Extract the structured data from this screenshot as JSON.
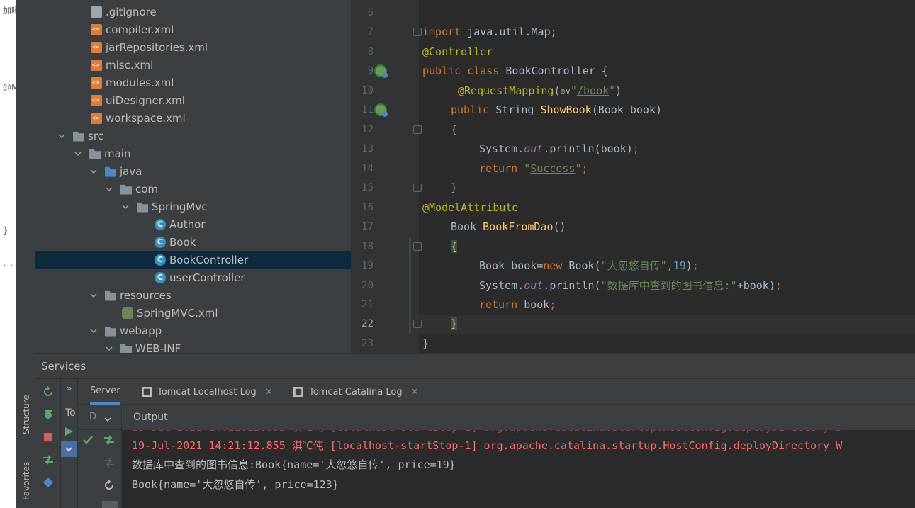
{
  "left_strip": {
    "text1": "加吗",
    "text2": "@M",
    "text3": "}",
    "text4": "` `"
  },
  "tool_stripe": {
    "structure": "Structure",
    "favorites": "Favorites"
  },
  "project_tree": {
    "items": [
      {
        "label": ".gitignore",
        "icon": "git-file-icon"
      },
      {
        "label": "compiler.xml",
        "icon": "xml-file-icon"
      },
      {
        "label": "jarRepositories.xml",
        "icon": "xml-file-icon"
      },
      {
        "label": "misc.xml",
        "icon": "xml-file-icon"
      },
      {
        "label": "modules.xml",
        "icon": "xml-file-icon"
      },
      {
        "label": "uiDesigner.xml",
        "icon": "xml-file-icon"
      },
      {
        "label": "workspace.xml",
        "icon": "xml-file-icon"
      },
      {
        "label": "src",
        "icon": "folder-icon"
      },
      {
        "label": "main",
        "icon": "folder-icon"
      },
      {
        "label": "java",
        "icon": "source-folder-icon"
      },
      {
        "label": "com",
        "icon": "package-icon"
      },
      {
        "label": "SpringMvc",
        "icon": "package-icon"
      },
      {
        "label": "Author",
        "icon": "class-icon"
      },
      {
        "label": "Book",
        "icon": "class-icon"
      },
      {
        "label": "BookController",
        "icon": "class-icon"
      },
      {
        "label": "userController",
        "icon": "class-icon"
      },
      {
        "label": "resources",
        "icon": "resources-folder-icon"
      },
      {
        "label": "SpringMVC.xml",
        "icon": "spring-xml-icon"
      },
      {
        "label": "webapp",
        "icon": "web-folder-icon"
      },
      {
        "label": "WEB-INF",
        "icon": "folder-icon"
      }
    ]
  },
  "editor": {
    "line_numbers": [
      "6",
      "7",
      "8",
      "9",
      "10",
      "11",
      "12",
      "13",
      "14",
      "15",
      "16",
      "17",
      "18",
      "19",
      "20",
      "21",
      "22",
      "23"
    ],
    "lines": {
      "l7_kw": "import",
      "l7_rest": " java.util.Map;",
      "l8_ann": "@Controller",
      "l9_kw": "public class",
      "l9_rest": " BookController {",
      "l10_ann": "@RequestMapping",
      "l10_open": "(",
      "l10_globe": "⊕∨",
      "l10_q1": "\"",
      "l10_path": "/book",
      "l10_q2": "\"",
      "l10_close": ")",
      "l11_kw": "public",
      "l11_type": " String ",
      "l11_fn": "ShowBook",
      "l11_rest": "(Book book)",
      "l12": "{",
      "l13_a": "System.",
      "l13_field": "out",
      "l13_b": ".println(book)",
      "l13_semi": ";",
      "l14_kw": "return",
      "l14_sp": " ",
      "l14_q1": "\"",
      "l14_str": "Success",
      "l14_q2": "\"",
      "l14_semi": ";",
      "l15": "}",
      "l16_ann": "@ModelAttribute",
      "l17_type": "Book ",
      "l17_fn": "BookFromDao",
      "l17_rest": "()",
      "l18": "{",
      "l19_a": "Book book=",
      "l19_kw": "new",
      "l19_b": " Book(",
      "l19_str": "\"大忽悠自传\"",
      "l19_comma": ",",
      "l19_num": "19",
      "l19_c": ")",
      "l19_semi": ";",
      "l20_a": "System.",
      "l20_field": "out",
      "l20_b": ".println(",
      "l20_str": "\"数据库中查到的图书信息:\"",
      "l20_c": "+book)",
      "l20_semi": ";",
      "l21_kw": "return",
      "l21_b": " book",
      "l21_semi": ";",
      "l22": "}",
      "l23": "}"
    }
  },
  "services": {
    "title": "Services",
    "tree_partial": "To",
    "tabs": [
      {
        "label": "Server"
      },
      {
        "label": "Tomcat Localhost Log"
      },
      {
        "label": "Tomcat Catalina Log"
      }
    ],
    "dropdown_text": "D",
    "output_label": "Output",
    "log_lines": [
      "19-Jul-2021 14:21:12.855 淇℃伅 [localhost-startStop-1] org.apache.catalina.startup.HostConfig.deployDirectory W",
      "数据库中查到的图书信息:Book{name='大忽悠自传', price=19}",
      "Book{name='大忽悠自传', price=123}"
    ]
  },
  "colors": {
    "keyword": "#cc7832",
    "annotation": "#bbb529",
    "string": "#6a8759",
    "function": "#ffc66d",
    "field": "#9876aa",
    "number": "#6897bb",
    "error_log": "#ff6b68"
  }
}
